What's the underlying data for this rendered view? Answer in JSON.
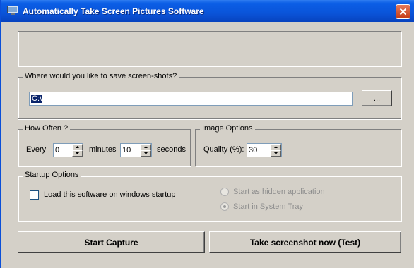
{
  "window": {
    "title": "Automatically Take Screen Pictures Software"
  },
  "save": {
    "legend": "Where would you like to save screen-shots?",
    "path": "C:\\",
    "browse_label": "..."
  },
  "how_often": {
    "legend": "How Often ?",
    "every_label": "Every",
    "minutes_value": "0",
    "minutes_label": "minutes",
    "seconds_value": "10",
    "seconds_label": "seconds"
  },
  "image_options": {
    "legend": "Image Options",
    "quality_label": "Quality (%):",
    "quality_value": "30"
  },
  "startup": {
    "legend": "Startup Options",
    "load_on_startup_label": "Load this software on windows startup",
    "load_on_startup_checked": false,
    "start_hidden_label": "Start as hidden application",
    "start_tray_label": "Start in System Tray",
    "selected": "Start in System Tray"
  },
  "actions": {
    "start_capture": "Start Capture",
    "take_now": "Take screenshot now (Test)"
  },
  "colors": {
    "titlebar": "#0a54d9",
    "window_bg": "#d4d0c8",
    "close": "#c43a14"
  }
}
